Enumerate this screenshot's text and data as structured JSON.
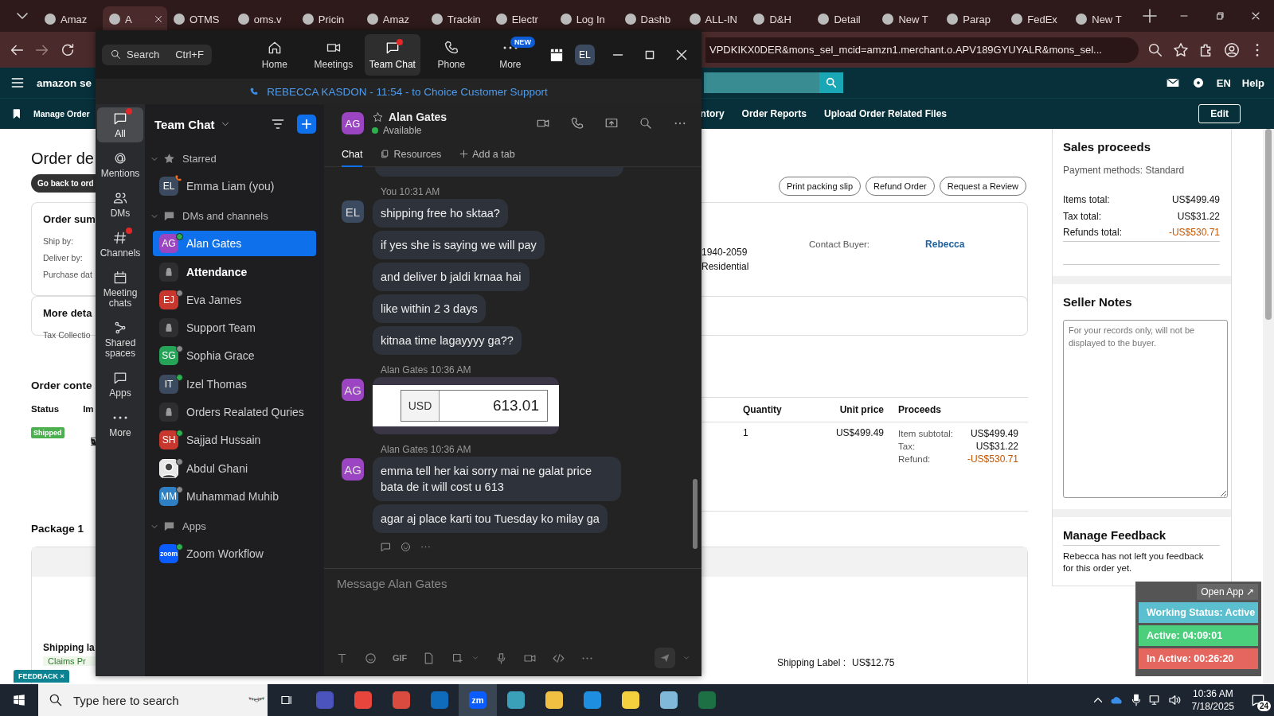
{
  "browser": {
    "tabs": [
      {
        "title": "Amaz",
        "selected": false
      },
      {
        "title": "A",
        "selected": true
      },
      {
        "title": "OTMS",
        "selected": false
      },
      {
        "title": "oms.v",
        "selected": false
      },
      {
        "title": "Pricin",
        "selected": false
      },
      {
        "title": "Amaz",
        "selected": false
      },
      {
        "title": "Trackin",
        "selected": false
      },
      {
        "title": "Electr",
        "selected": false
      },
      {
        "title": "Log In",
        "selected": false
      },
      {
        "title": "Dashb",
        "selected": false
      },
      {
        "title": "ALL-IN",
        "selected": false
      },
      {
        "title": "D&H",
        "selected": false
      },
      {
        "title": "Detail",
        "selected": false
      },
      {
        "title": "New T",
        "selected": false
      },
      {
        "title": "Parap",
        "selected": false
      },
      {
        "title": "FedEx",
        "selected": false
      },
      {
        "title": "New T",
        "selected": false
      }
    ],
    "url": "VPDKIKX0DER&mons_sel_mcid=amzn1.merchant.o.APV189GYUYALR&mons_sel..."
  },
  "amazon": {
    "logo": "amazon se",
    "language": "EN",
    "help": "Help",
    "nav": [
      "Manage Order",
      "ntory",
      "Order Reports",
      "Upload Order Related Files"
    ],
    "edit": "Edit",
    "title": "Order de",
    "back": "Go back to ord",
    "actions": [
      "Print packing slip",
      "Refund Order",
      "Request a Review"
    ],
    "summary": {
      "title": "Order sum",
      "labels": [
        "Ship by:",
        "Deliver by:",
        "Purchase dat"
      ],
      "phone": "1940-2059",
      "address_type": "Residential",
      "contact_label": "Contact Buyer:",
      "contact": "Rebecca"
    },
    "more": {
      "title": "More deta",
      "label": "Tax Collectio"
    },
    "contents": {
      "title": "Order conte",
      "columns_left": [
        "Status",
        "Im"
      ],
      "columns_right": [
        "Quantity",
        "Unit price",
        "Proceeds"
      ],
      "status": "Shipped",
      "quantity": "1",
      "unit_price": "US$499.49",
      "proceeds": [
        {
          "label": "Item subtotal:",
          "value": "US$499.49",
          "negative": false
        },
        {
          "label": "Tax:",
          "value": "US$31.22",
          "negative": false
        },
        {
          "label": "Refund:",
          "value": "-US$530.71",
          "negative": true
        }
      ]
    },
    "package": {
      "title": "Package 1",
      "label_title": "Shipping la",
      "claims": "Claims Pr",
      "shipping_label": "Shipping Label :",
      "shipping_value": "US$12.75"
    },
    "feedback_tab": "FEEDBACK",
    "feedback_close": "×",
    "sidebar": {
      "proceeds_title": "Sales proceeds",
      "payment": "Payment methods: Standard",
      "totals": [
        {
          "label": "Items total:",
          "value": "US$499.49",
          "negative": false
        },
        {
          "label": "Tax total:",
          "value": "US$31.22",
          "negative": false
        },
        {
          "label": "Refunds total:",
          "value": "-US$530.71",
          "negative": true
        }
      ],
      "notes_title": "Seller Notes",
      "notes_placeholder": "For your records only, will not be displayed to the buyer.",
      "feedback_title": "Manage Feedback",
      "feedback_text": "Rebecca has not left you feedback for this order yet."
    }
  },
  "tracker": {
    "open": "Open App ↗",
    "rows": [
      {
        "text": "Working Status: Active",
        "color": "#5bbfcf"
      },
      {
        "text": "Active: 04:09:01",
        "color": "#4ccf7c"
      },
      {
        "text": "In Active: 00:26:20",
        "color": "#e5665e"
      }
    ]
  },
  "zoom": {
    "search": "Search",
    "shortcut": "Ctrl+F",
    "nav": [
      {
        "label": "Home",
        "selected": false,
        "unread": false
      },
      {
        "label": "Meetings",
        "selected": false,
        "unread": false
      },
      {
        "label": "Team Chat",
        "selected": true,
        "unread": true
      },
      {
        "label": "Phone",
        "selected": false,
        "unread": false
      },
      {
        "label": "More",
        "selected": false,
        "unread": false,
        "badge": "NEW"
      }
    ],
    "user": "EL",
    "banner": "REBECCA KASDON - 11:54 - to Choice Customer Support",
    "rail": [
      {
        "label": "All",
        "selected": true,
        "unread": true
      },
      {
        "label": "Mentions",
        "selected": false,
        "unread": false
      },
      {
        "label": "DMs",
        "selected": false,
        "unread": false
      },
      {
        "label": "Channels",
        "selected": false,
        "unread": true
      },
      {
        "label": "Meeting chats",
        "selected": false,
        "unread": false
      },
      {
        "label": "Shared spaces",
        "selected": false,
        "unread": false
      },
      {
        "label": "Apps",
        "selected": false,
        "unread": false
      },
      {
        "label": "More",
        "selected": false,
        "unread": false
      }
    ],
    "list_title": "Team Chat",
    "sections": [
      {
        "title": "Starred",
        "expanded": true,
        "items": [
          {
            "name": "Emma Liam (you)",
            "initials": "EL",
            "color": "#3b4a5e",
            "kind": "person",
            "on_call": true,
            "selected": false,
            "unread": false
          }
        ]
      },
      {
        "title": "DMs and channels",
        "expanded": true,
        "items": [
          {
            "name": "Alan Gates",
            "initials": "AG",
            "color": "#9b45c2",
            "kind": "person",
            "online": true,
            "selected": true,
            "unread": false
          },
          {
            "name": "Attendance",
            "kind": "channel",
            "selected": false,
            "unread": true
          },
          {
            "name": "Eva James",
            "initials": "EJ",
            "color": "#c8372d",
            "kind": "person",
            "online": false,
            "selected": false,
            "unread": false
          },
          {
            "name": "Support Team",
            "kind": "channel",
            "selected": false,
            "unread": false
          },
          {
            "name": "Sophia Grace",
            "initials": "SG",
            "color": "#25a457",
            "kind": "person",
            "online": false,
            "selected": false,
            "unread": false
          },
          {
            "name": "Izel Thomas",
            "initials": "IT",
            "color": "#3b4a5e",
            "kind": "person",
            "online": true,
            "selected": false,
            "unread": false
          },
          {
            "name": "Orders Realated Quries",
            "kind": "channel",
            "selected": false,
            "unread": false
          },
          {
            "name": "Sajjad Hussain",
            "initials": "SH",
            "color": "#c8372d",
            "kind": "person",
            "online": true,
            "selected": false,
            "unread": false
          },
          {
            "name": "Abdul Ghani",
            "online": false,
            "selected": false,
            "unread": false
          },
          {
            "name": "Muhammad Muhib",
            "initials": "MM",
            "color": "#2f7fc4",
            "kind": "person",
            "online": false,
            "selected": false,
            "unread": false
          }
        ]
      },
      {
        "title": "Apps",
        "expanded": true,
        "items": [
          {
            "name": "Zoom Workflow",
            "initials": "zoom",
            "color": "#0b5cff",
            "kind": "app",
            "online": true,
            "selected": false,
            "unread": false
          }
        ]
      }
    ],
    "chat": {
      "name": "Alan Gates",
      "initials": "AG",
      "color": "#9b45c2",
      "presence": "Available",
      "tabs": [
        {
          "label": "Chat",
          "selected": true
        },
        {
          "label": "Resources",
          "selected": false
        },
        {
          "label": "Add a tab",
          "selected": false
        }
      ],
      "groups": [
        {
          "sender": "You",
          "time": "10:31 AM",
          "initials": "EL",
          "color": "#3b4a5e",
          "messages": [
            {
              "kind": "text",
              "text": "shipping free ho sktaa?"
            },
            {
              "kind": "text",
              "text": "if yes she is saying we will pay"
            },
            {
              "kind": "text",
              "text": "and deliver b jaldi krnaa hai"
            },
            {
              "kind": "text",
              "text": "like within 2 3 days"
            },
            {
              "kind": "text",
              "text": "kitnaa time lagayyyy ga??"
            }
          ]
        },
        {
          "sender": "Alan Gates",
          "time": "10:36 AM",
          "initials": "AG",
          "color": "#9b45c2",
          "messages": [
            {
              "currency": "USD",
              "amount": "613.01"
            }
          ]
        },
        {
          "sender": "Alan Gates",
          "time": "10:36 AM",
          "initials": "AG",
          "color": "#9b45c2",
          "messages": [
            {
              "kind": "text",
              "text": "emma tell her kai sorry mai ne galat price bata de it will cost u 613"
            },
            {
              "kind": "text",
              "text": "agar aj place karti tou Tuesday ko milay ga"
            }
          ]
        }
      ],
      "composer_placeholder": "Message Alan Gates",
      "gif": "GIF"
    }
  },
  "taskbar": {
    "search": "Type here to search",
    "apps": [
      {
        "selected": false
      },
      {
        "selected": false
      },
      {
        "selected": false
      },
      {
        "selected": false
      },
      {
        "selected": true,
        "label": "zm"
      },
      {
        "selected": false
      },
      {
        "selected": false
      },
      {
        "selected": false
      },
      {
        "selected": false
      },
      {
        "selected": false
      },
      {
        "selected": false
      }
    ],
    "time": "10:36 AM",
    "date": "7/18/2025",
    "notifications": "24"
  }
}
